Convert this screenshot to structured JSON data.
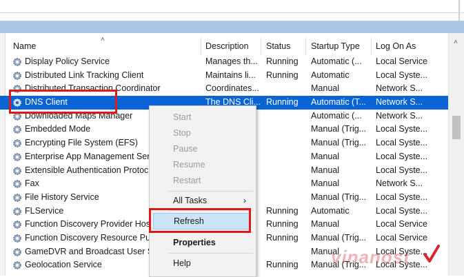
{
  "columns": {
    "name": "Name",
    "description": "Description",
    "status": "Status",
    "startup_type": "Startup Type",
    "log_on_as": "Log On As"
  },
  "services": [
    {
      "name": "Display Policy Service",
      "description": "Manages th...",
      "status": "Running",
      "startup": "Automatic (...",
      "logon": "Local Service"
    },
    {
      "name": "Distributed Link Tracking Client",
      "description": "Maintains li...",
      "status": "Running",
      "startup": "Automatic",
      "logon": "Local Syste..."
    },
    {
      "name": "Distributed Transaction Coordinator",
      "description": "Coordinates...",
      "status": "",
      "startup": "Manual",
      "logon": "Network S..."
    },
    {
      "name": "DNS Client",
      "description": "The DNS Cli...",
      "status": "Running",
      "startup": "Automatic (T...",
      "logon": "Network S...",
      "selected": true
    },
    {
      "name": "Downloaded Maps Manager",
      "description": "",
      "status": "",
      "startup": "Automatic (...",
      "logon": "Network S..."
    },
    {
      "name": "Embedded Mode",
      "description": "",
      "status": "",
      "startup": "Manual (Trig...",
      "logon": "Local Syste..."
    },
    {
      "name": "Encrypting File System (EFS)",
      "description": "",
      "status": "",
      "startup": "Manual (Trig...",
      "logon": "Local Syste..."
    },
    {
      "name": "Enterprise App Management Ser",
      "description": "",
      "status": "",
      "startup": "Manual",
      "logon": "Local Syste..."
    },
    {
      "name": "Extensible Authentication Protoc",
      "description": "",
      "status": "",
      "startup": "Manual",
      "logon": "Local Syste..."
    },
    {
      "name": "Fax",
      "description": "",
      "status": "",
      "startup": "Manual",
      "logon": "Network S..."
    },
    {
      "name": "File History Service",
      "description": "",
      "status": "",
      "startup": "Manual (Trig...",
      "logon": "Local Syste..."
    },
    {
      "name": "FLService",
      "description": "",
      "status": "Running",
      "startup": "Automatic",
      "logon": "Local Syste..."
    },
    {
      "name": "Function Discovery Provider Hos",
      "description": "",
      "status": "Running",
      "startup": "Manual",
      "logon": "Local Service"
    },
    {
      "name": "Function Discovery Resource Pul",
      "description": "",
      "status": "Running",
      "startup": "Manual (Trig...",
      "logon": "Local Service"
    },
    {
      "name": "GameDVR and Broadcast User Se",
      "description": "",
      "status": "",
      "startup": "Manual",
      "logon": "Local Syste..."
    },
    {
      "name": "Geolocation Service",
      "description": "",
      "status": "Running",
      "startup": "Manual (Trig...",
      "logon": "Local Syste..."
    }
  ],
  "context_menu": {
    "start": "Start",
    "stop": "Stop",
    "pause": "Pause",
    "resume": "Resume",
    "restart": "Restart",
    "all_tasks": "All Tasks",
    "all_tasks_arrow": "›",
    "refresh": "Refresh",
    "properties": "Properties",
    "help": "Help"
  },
  "scrollbar": {
    "up_arrow": "˄"
  },
  "sort_indicator": "˄",
  "watermark": {
    "text": "vinanost",
    "color": "#d7262e"
  },
  "colors": {
    "selection": "#0a64d6",
    "highlight_box": "#e01818",
    "menu_hover": "#cce4f7"
  }
}
